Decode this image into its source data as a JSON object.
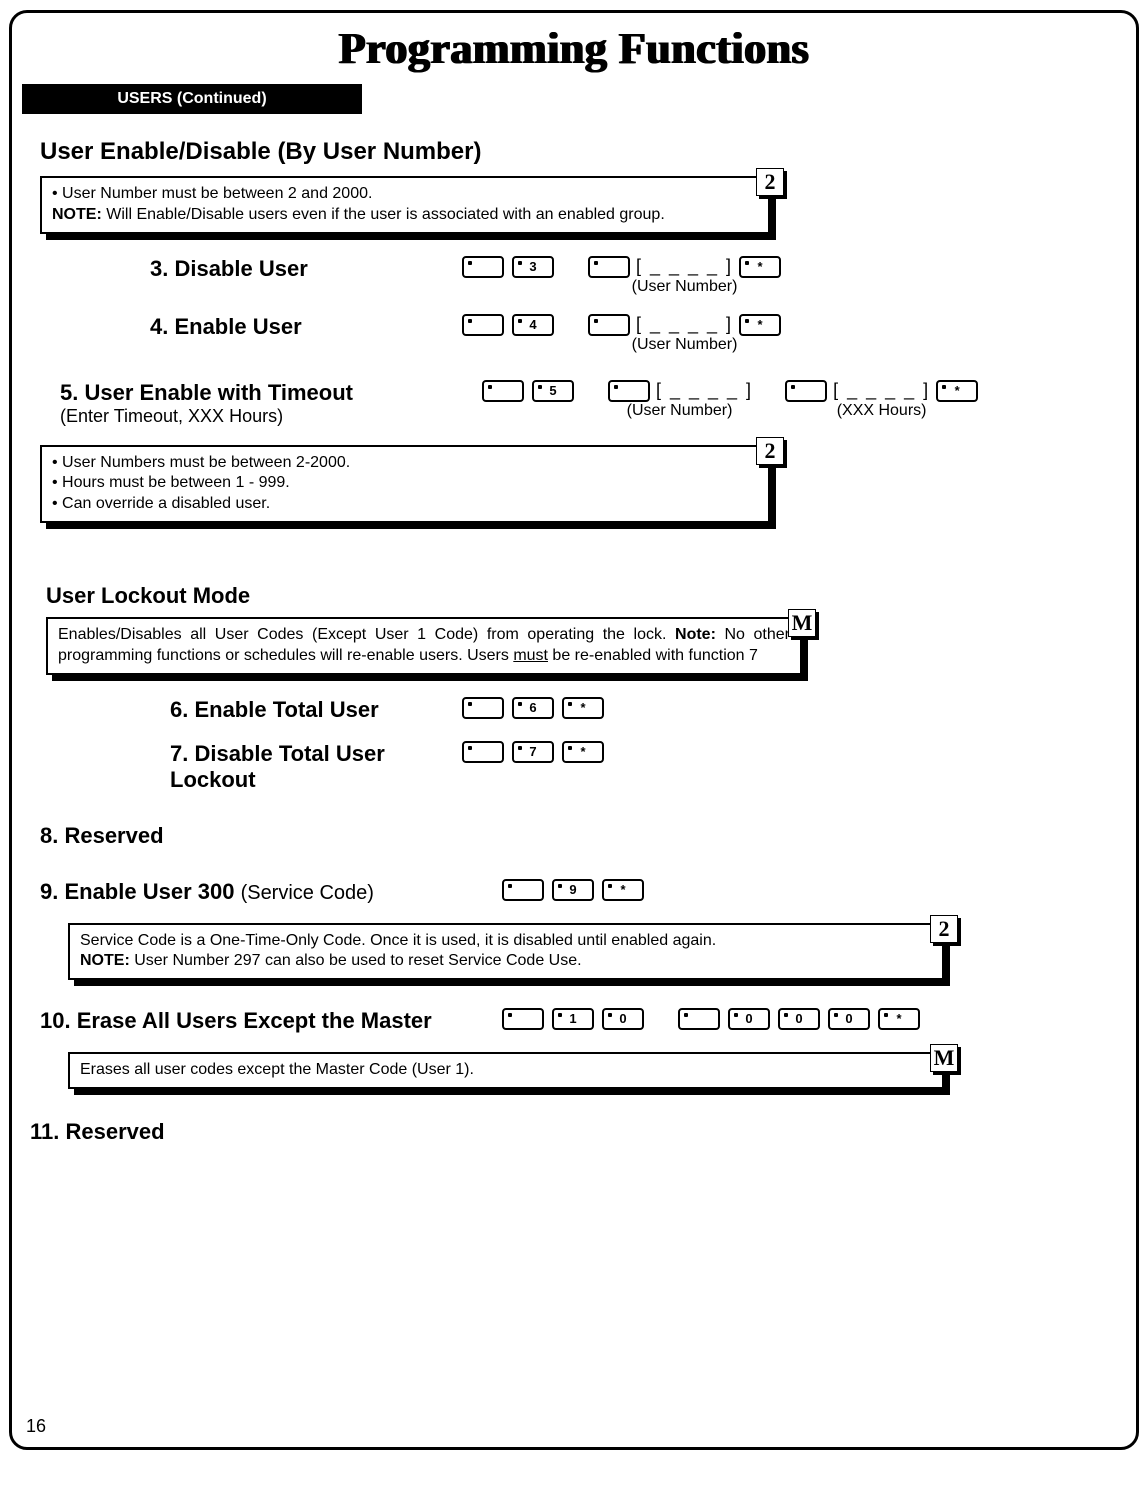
{
  "page_title": "Programming Functions",
  "section_tag": "USERS (Continued)",
  "sec1": {
    "heading": "User Enable/Disable",
    "heading_sub": "(By User Number)",
    "box_line1": "• User Number must be between 2 and 2000.",
    "box_note_label": "NOTE:",
    "box_note_text": "  Will Enable/Disable users even if the user is associated with an enabled group.",
    "level": "2",
    "fn3": {
      "label": "3. Disable User",
      "user_number_label": "(User Number)"
    },
    "fn4": {
      "label": "4. Enable User",
      "user_number_label": "(User Number)"
    },
    "fn5": {
      "label": "5. User Enable with Timeout",
      "subline": "(Enter Timeout, XXX Hours)",
      "user_number_label": "(User Number)",
      "hours_label": "(XXX Hours)"
    },
    "box2_line1": "• User Numbers must be between 2-2000.",
    "box2_line2": "• Hours must be between 1 - 999.",
    "box2_line3": "• Can override a disabled user.",
    "level2": "2"
  },
  "sec2": {
    "heading": "User Lockout Mode",
    "box_text1": "Enables/Disables all User Codes (Except User 1 Code)  from operating the lock.  ",
    "box_note_label": "Note:",
    "box_text2": "  No other programming functions or schedules will re-enable users.  Users ",
    "box_must": "must",
    "box_text3": " be re-enabled with function 7",
    "level": "M",
    "fn6": {
      "label": "6. Enable Total User"
    },
    "fn7": {
      "label": "7. Disable Total User Lockout"
    }
  },
  "fn8": {
    "label": "8. Reserved"
  },
  "fn9": {
    "label_bold": "9. Enable User 300 ",
    "label_light": "(Service Code)",
    "box_line1": "Service Code is a One-Time-Only Code.  Once it is used, it is disabled until enabled again.",
    "box_note_label": "NOTE:",
    "box_note_text": " User Number 297 can also be used to reset Service Code Use.",
    "level": "2"
  },
  "fn10": {
    "label": "10. Erase All Users Except the Master",
    "box_text": "Erases all user codes except the Master Code (User 1).",
    "level": "M"
  },
  "fn11": {
    "label": "11. Reserved"
  },
  "page_number": "16",
  "key_labels": {
    "blank": "",
    "k0": "0",
    "k1": "1",
    "k3": "3",
    "k4": "4",
    "k5": "5",
    "k6": "6",
    "k7": "7",
    "k9": "9",
    "star": "*",
    "placeholder": "[ _ _ _ _ ]",
    "placeholder3": "[ _ _ _ ]"
  }
}
